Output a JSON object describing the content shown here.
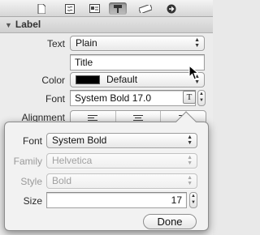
{
  "toolbar": {
    "icons": [
      "file-inspector-icon",
      "quick-help-icon",
      "identity-inspector-icon",
      "attributes-inspector-icon",
      "size-inspector-icon",
      "connections-inspector-icon"
    ],
    "active_index": 3
  },
  "section": {
    "title": "Label"
  },
  "label_props": {
    "text_label": "Text",
    "text_value": "Plain",
    "title_value": "Title",
    "color_label": "Color",
    "color_value": "Default",
    "color_swatch": "#000000",
    "font_label": "Font",
    "font_value": "System Bold 17.0",
    "font_button": "T",
    "alignment_label": "Alignment"
  },
  "font_popover": {
    "font_label": "Font",
    "font_value": "System Bold",
    "family_label": "Family",
    "family_value": "Helvetica",
    "style_label": "Style",
    "style_value": "Bold",
    "size_label": "Size",
    "size_value": "17",
    "done_label": "Done"
  }
}
